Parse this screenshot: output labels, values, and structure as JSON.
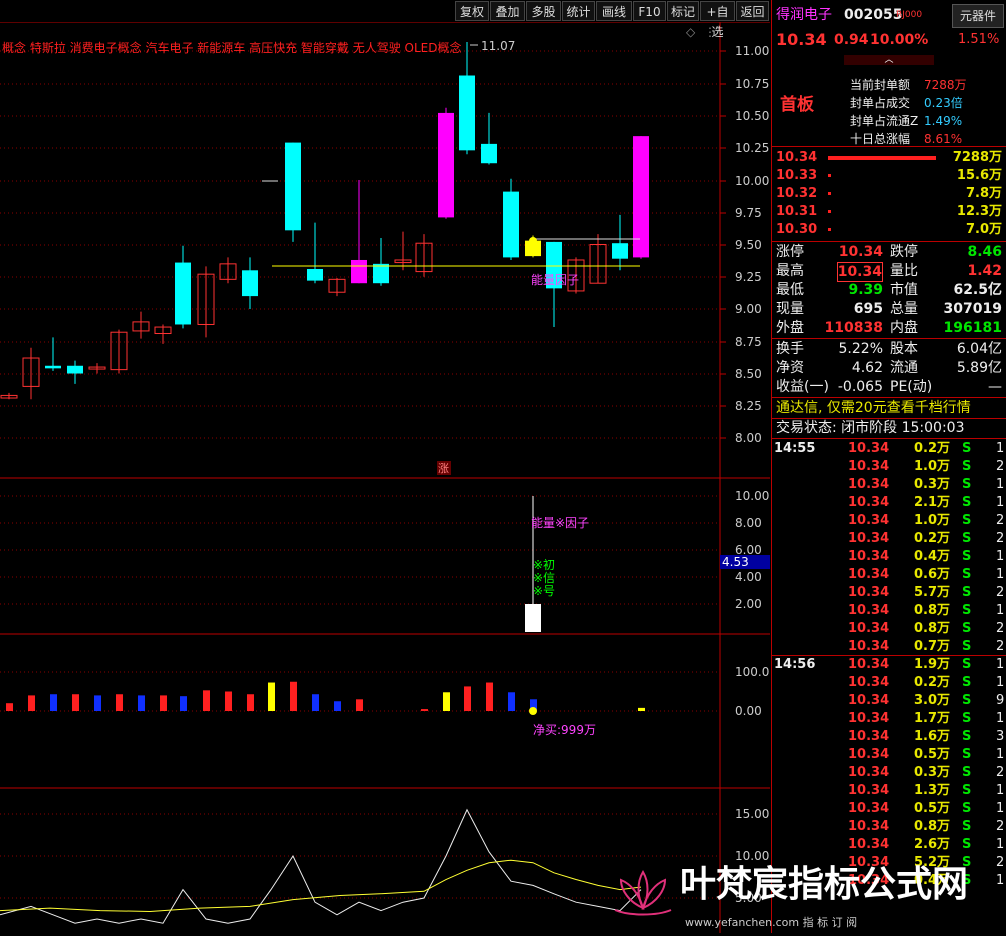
{
  "toolbar": {
    "buttons": [
      "复权",
      "叠加",
      "多股",
      "统计",
      "画线",
      "F10",
      "标记",
      "+自选",
      "返回"
    ]
  },
  "concepts": "概念 特斯拉 消费电子概念 汽车电子 新能源车 高压快充 智能穿戴 无人驾驶 OLED概念",
  "price_axis": [
    "11.00",
    "10.75",
    "10.50",
    "10.25",
    "10.00",
    "9.75",
    "9.50",
    "9.25",
    "9.00",
    "8.75",
    "8.50",
    "8.25",
    "8.00"
  ],
  "high_label": "11.07",
  "energy_label": "能量因子",
  "limit_up_mark": "涨",
  "energy_panel": {
    "axis": [
      "10.00",
      "8.00",
      "6.00",
      "4.00",
      "2.00"
    ],
    "value_box": "4.53",
    "title": "能量※因子",
    "signal_lines": [
      "※初",
      "※信",
      "※号"
    ]
  },
  "flow_panel": {
    "axis": [
      "100.0",
      "0.00"
    ],
    "net_buy": "净买:999万"
  },
  "osc_panel": {
    "axis": [
      "15.00",
      "10.00",
      "5.00"
    ]
  },
  "stock": {
    "name": "得润电子",
    "code": "002055",
    "tag": "RJ000",
    "btn": "元器件",
    "price": "10.34",
    "change": "0.94",
    "pct": "10.00%",
    "right_pct": "1.51%",
    "board": "首板",
    "seal_rows": [
      {
        "label": "当前封单额",
        "value": "7288万"
      },
      {
        "label": "封单占成交",
        "value": "0.23倍"
      },
      {
        "label": "封单占流通Z",
        "value": "1.49%"
      },
      {
        "label": "十日总涨幅",
        "value": "8.61%"
      }
    ]
  },
  "orderbook": [
    {
      "price": "10.34",
      "vol": "7288万",
      "bar": "big"
    },
    {
      "price": "10.33",
      "vol": "15.6万"
    },
    {
      "price": "10.32",
      "vol": "7.8万"
    },
    {
      "price": "10.31",
      "vol": "12.3万"
    },
    {
      "price": "10.30",
      "vol": "7.0万"
    }
  ],
  "stats": [
    {
      "l1": "涨停",
      "v1": "10.34",
      "l2": "跌停",
      "v2": "8.46"
    },
    {
      "l1": "最高",
      "v1": "10.34",
      "l2": "量比",
      "v2": "1.42"
    },
    {
      "l1": "最低",
      "v1": "9.39",
      "l2": "市值",
      "v2": "62.5亿"
    },
    {
      "l1": "现量",
      "v1": "695",
      "l2": "总量",
      "v2": "307019"
    },
    {
      "l1": "外盘",
      "v1": "110838",
      "l2": "内盘",
      "v2": "196181"
    }
  ],
  "stats2": [
    {
      "l1": "换手",
      "v1": "5.22%",
      "l2": "股本",
      "v2": "6.04亿"
    },
    {
      "l1": "净资",
      "v1": "4.62",
      "l2": "流通",
      "v2": "5.89亿"
    },
    {
      "l1": "收益(一)",
      "v1": "-0.065",
      "l2": "PE(动)",
      "v2": "—"
    }
  ],
  "promo": "通达信, 仅需20元查看千档行情",
  "trade_status": "交易状态: 闭市阶段 15:00:03",
  "ticks_a": {
    "time": "14:55",
    "rows": [
      [
        "10.34",
        "0.2万",
        "S",
        "1"
      ],
      [
        "10.34",
        "1.0万",
        "S",
        "2"
      ],
      [
        "10.34",
        "0.3万",
        "S",
        "1"
      ],
      [
        "10.34",
        "2.1万",
        "S",
        "1"
      ],
      [
        "10.34",
        "1.0万",
        "S",
        "2"
      ],
      [
        "10.34",
        "0.2万",
        "S",
        "2"
      ],
      [
        "10.34",
        "0.4万",
        "S",
        "1"
      ],
      [
        "10.34",
        "0.6万",
        "S",
        "1"
      ],
      [
        "10.34",
        "5.7万",
        "S",
        "2"
      ],
      [
        "10.34",
        "0.8万",
        "S",
        "1"
      ],
      [
        "10.34",
        "0.8万",
        "S",
        "2"
      ],
      [
        "10.34",
        "0.7万",
        "S",
        "2"
      ]
    ]
  },
  "ticks_b": {
    "time": "14:56",
    "rows": [
      [
        "10.34",
        "1.9万",
        "S",
        "1"
      ],
      [
        "10.34",
        "0.2万",
        "S",
        "1"
      ],
      [
        "10.34",
        "3.0万",
        "S",
        "9"
      ],
      [
        "10.34",
        "1.7万",
        "S",
        "1"
      ],
      [
        "10.34",
        "1.6万",
        "S",
        "3"
      ],
      [
        "10.34",
        "0.5万",
        "S",
        "1"
      ],
      [
        "10.34",
        "0.3万",
        "S",
        "2"
      ],
      [
        "10.34",
        "1.3万",
        "S",
        "1"
      ],
      [
        "10.34",
        "0.5万",
        "S",
        "1"
      ],
      [
        "10.34",
        "0.8万",
        "S",
        "2"
      ],
      [
        "10.34",
        "2.6万",
        "S",
        "1"
      ],
      [
        "10.34",
        "5.2万",
        "S",
        "2"
      ],
      [
        "10.34",
        "0.4万",
        "S",
        "1"
      ]
    ]
  },
  "watermark": {
    "title": "叶梵宸指标公式网",
    "sub": "www.yefanchen.com  指 标 订 阅"
  },
  "colors": {
    "up": "#ff3232",
    "down": "#00ffff",
    "limit": "#ff00ff",
    "yellow": "#ffff00",
    "blue": "#0000ff"
  }
}
